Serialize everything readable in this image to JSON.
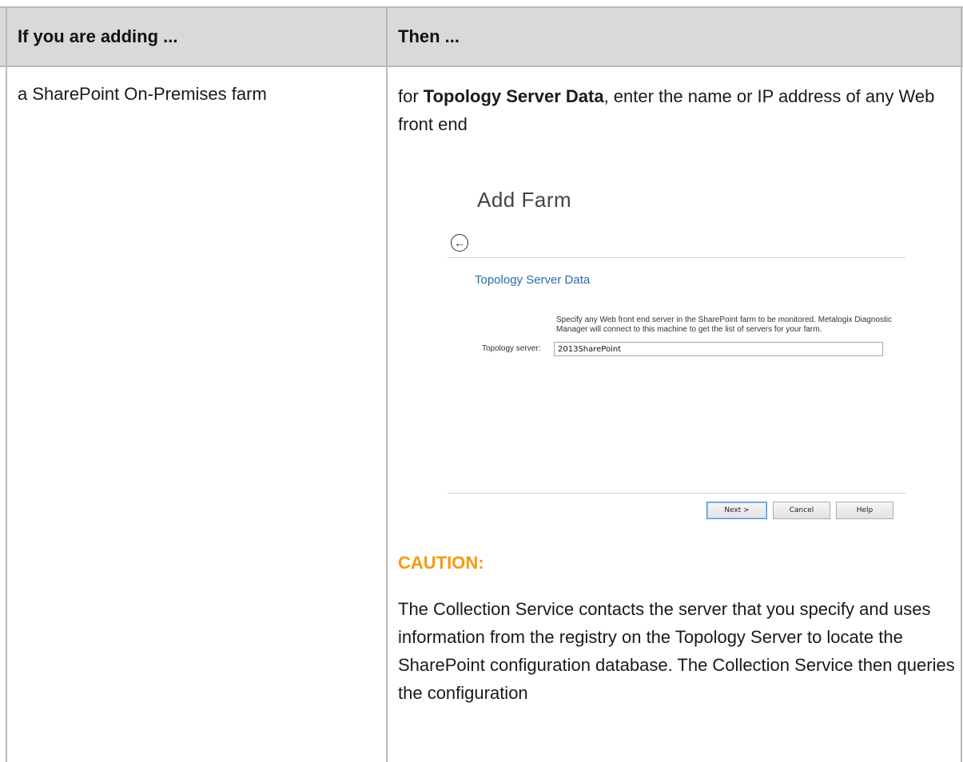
{
  "table": {
    "header": {
      "col1": "If you are adding  ...",
      "col2": "Then ..."
    },
    "row": {
      "left": "a SharePoint On-Premises farm",
      "intro_prefix": "for ",
      "intro_bold": "Topology Server Data",
      "intro_suffix": ", enter the name or IP address of any Web front end"
    }
  },
  "dialog": {
    "title": "Add Farm",
    "back_icon": "back-arrow-circle-icon",
    "section_title": "Topology Server Data",
    "description": "Specify any Web front end server in the SharePoint farm to be monitored. Metalogix Diagnostic Manager will connect to this machine to get the list of servers for your farm.",
    "topology_label": "Topology server:",
    "topology_value": "2013SharePoint",
    "buttons": {
      "next": "Next >",
      "cancel": "Cancel",
      "help": "Help"
    }
  },
  "caution": {
    "label": "CAUTION:",
    "text": "The Collection Service contacts the server that you specify and uses information from the registry on the Topology Server to locate the SharePoint configuration database. The Collection Service then queries the configuration"
  },
  "colors": {
    "caution": "#f39a12",
    "section_title": "#2c6aa8",
    "header_bg": "#d9d9d9"
  }
}
